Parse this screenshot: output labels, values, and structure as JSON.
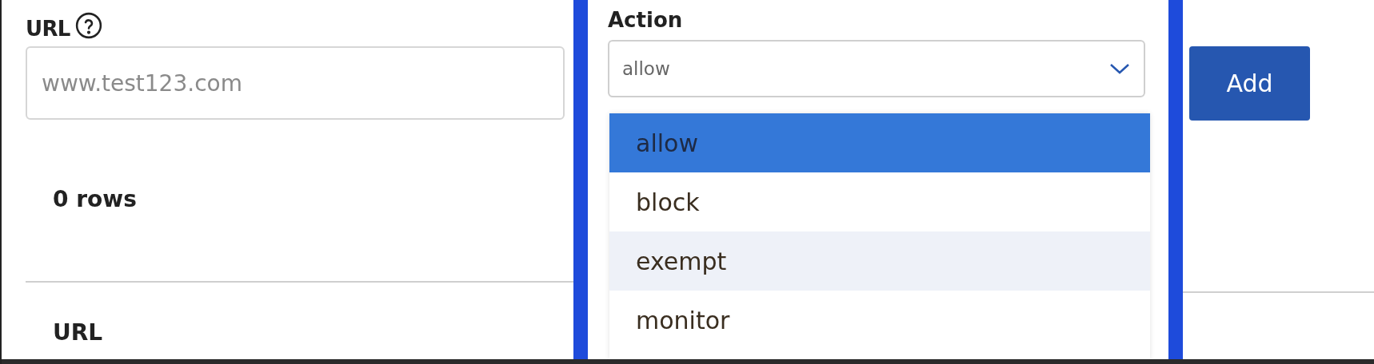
{
  "url_field": {
    "label": "URL",
    "placeholder": "www.test123.com"
  },
  "action_field": {
    "label": "Action",
    "value": "allow",
    "expanded": true,
    "options": [
      {
        "label": "allow",
        "selected": true,
        "hovered": false
      },
      {
        "label": "block",
        "selected": false,
        "hovered": false
      },
      {
        "label": "exempt",
        "selected": false,
        "hovered": true
      },
      {
        "label": "monitor",
        "selected": false,
        "hovered": false
      }
    ]
  },
  "add_button": "Add",
  "row_count": "0 rows",
  "table": {
    "columns": [
      "URL"
    ]
  }
}
